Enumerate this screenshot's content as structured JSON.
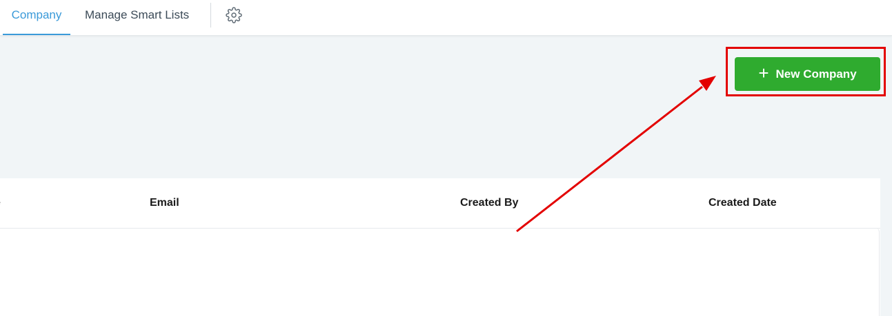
{
  "tabs": [
    {
      "label": "Company",
      "active": true
    },
    {
      "label": "Manage Smart Lists",
      "active": false
    }
  ],
  "settings_icon": "gear-icon",
  "actions": {
    "new_company_label": "New Company",
    "new_company_icon": "plus-icon"
  },
  "table": {
    "columns": [
      "e",
      "Email",
      "Created By",
      "Created Date"
    ]
  },
  "colors": {
    "accent": "#3a9ad9",
    "primary_button": "#2fab2f",
    "annotation": "#e30000",
    "background": "#f1f5f7"
  }
}
